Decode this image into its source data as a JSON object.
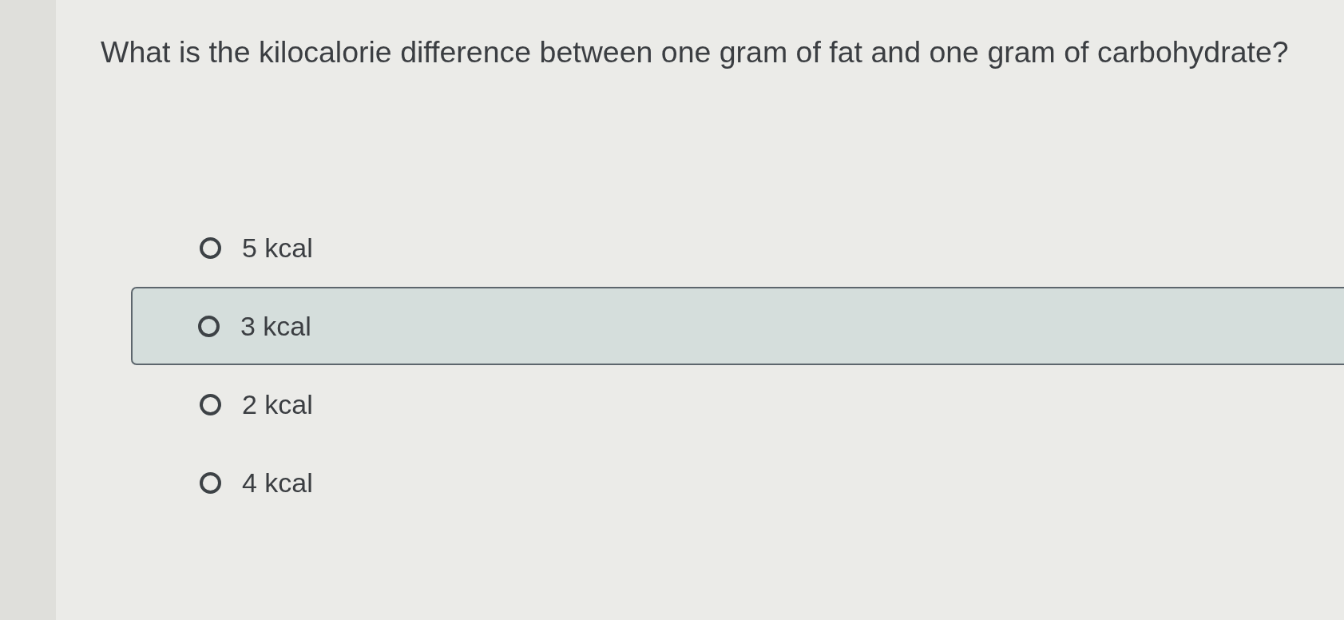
{
  "question": "What is the kilocalorie difference between one gram of fat and one gram of carbohydrate?",
  "options": [
    {
      "label": "5 kcal",
      "checked": false,
      "highlighted": false
    },
    {
      "label": "3 kcal",
      "checked": false,
      "highlighted": true
    },
    {
      "label": "2 kcal",
      "checked": false,
      "highlighted": false
    },
    {
      "label": "4 kcal",
      "checked": false,
      "highlighted": false
    }
  ]
}
